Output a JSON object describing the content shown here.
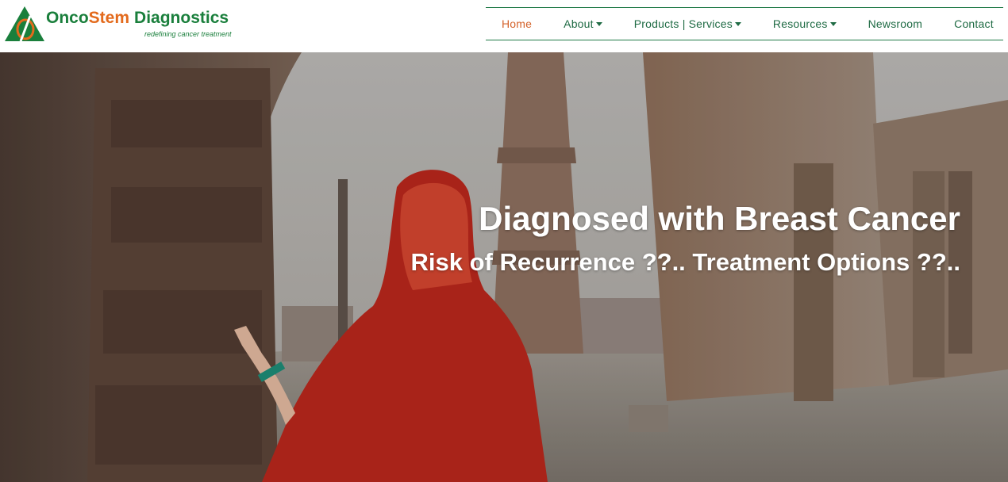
{
  "brand": {
    "name_part1": "Onco",
    "name_part2": "Stem",
    "name_part3": "Diagnostics",
    "tagline": "redefining cancer treatment",
    "colors": {
      "green": "#1a7f3c",
      "orange": "#e36a1c"
    }
  },
  "nav": {
    "items": [
      {
        "label": "Home",
        "active": true,
        "dropdown": false
      },
      {
        "label": "About",
        "active": false,
        "dropdown": true
      },
      {
        "label": "Products | Services",
        "active": false,
        "dropdown": true
      },
      {
        "label": "Resources",
        "active": false,
        "dropdown": true
      },
      {
        "label": "Newsroom",
        "active": false,
        "dropdown": false
      },
      {
        "label": "Contact",
        "active": false,
        "dropdown": false
      }
    ],
    "colors": {
      "text": "#1f6b44",
      "active": "#d4622a",
      "border": "#1f7a47"
    }
  },
  "hero": {
    "title": "Diagnosed with Breast Cancer",
    "subtitle": "Risk of Recurrence ??.. Treatment Options ??..",
    "image": "woman-in-red-at-qutub-minar-photo"
  }
}
